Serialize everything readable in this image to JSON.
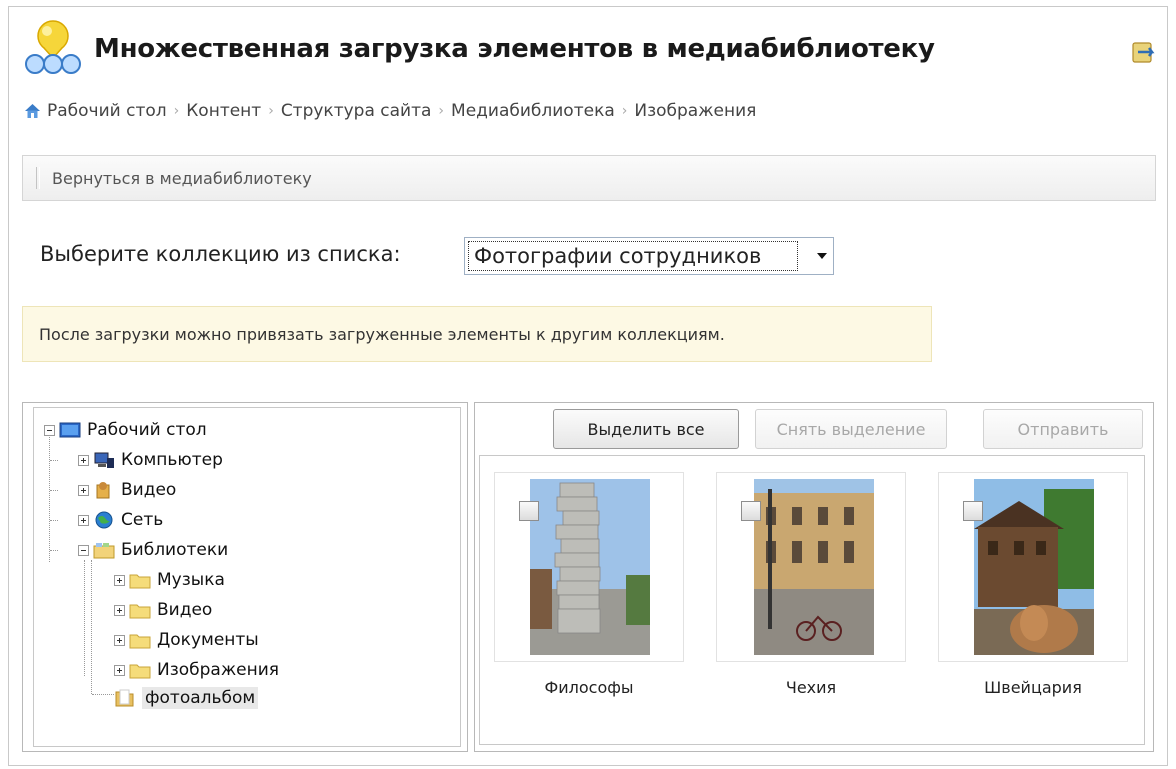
{
  "header": {
    "title": "Множественная загрузка элементов в медиабиблиотеку"
  },
  "breadcrumb": [
    "Рабочий стол",
    "Контент",
    "Структура сайта",
    "Медиабиблиотека",
    "Изображения"
  ],
  "toolbar": {
    "back_label": "Вернуться в медиабиблиотеку"
  },
  "collection": {
    "label": "Выберите коллекцию из списка:",
    "selected": "Фотографии сотрудников"
  },
  "notice": "После загрузки можно привязать загруженные элементы к другим коллекциям.",
  "tree": {
    "root": "Рабочий стол",
    "items": [
      "Компьютер",
      "Видео",
      "Сеть",
      "Библиотеки"
    ],
    "library_items": [
      "Музыка",
      "Видео",
      "Документы",
      "Изображения"
    ],
    "selected": "фотоальбом"
  },
  "buttons": {
    "select_all": "Выделить все",
    "deselect": "Снять выделение",
    "send": "Отправить"
  },
  "photos": [
    {
      "caption": "Философы",
      "checked": false
    },
    {
      "caption": "Чехия",
      "checked": false
    },
    {
      "caption": "Швейцария",
      "checked": false
    }
  ],
  "colors": {
    "notice_bg": "#fdf9e4",
    "folder_yellow": "#f5dc7a",
    "logo_yellow": "#f6d63a",
    "logo_blue": "#4a8fd8"
  }
}
